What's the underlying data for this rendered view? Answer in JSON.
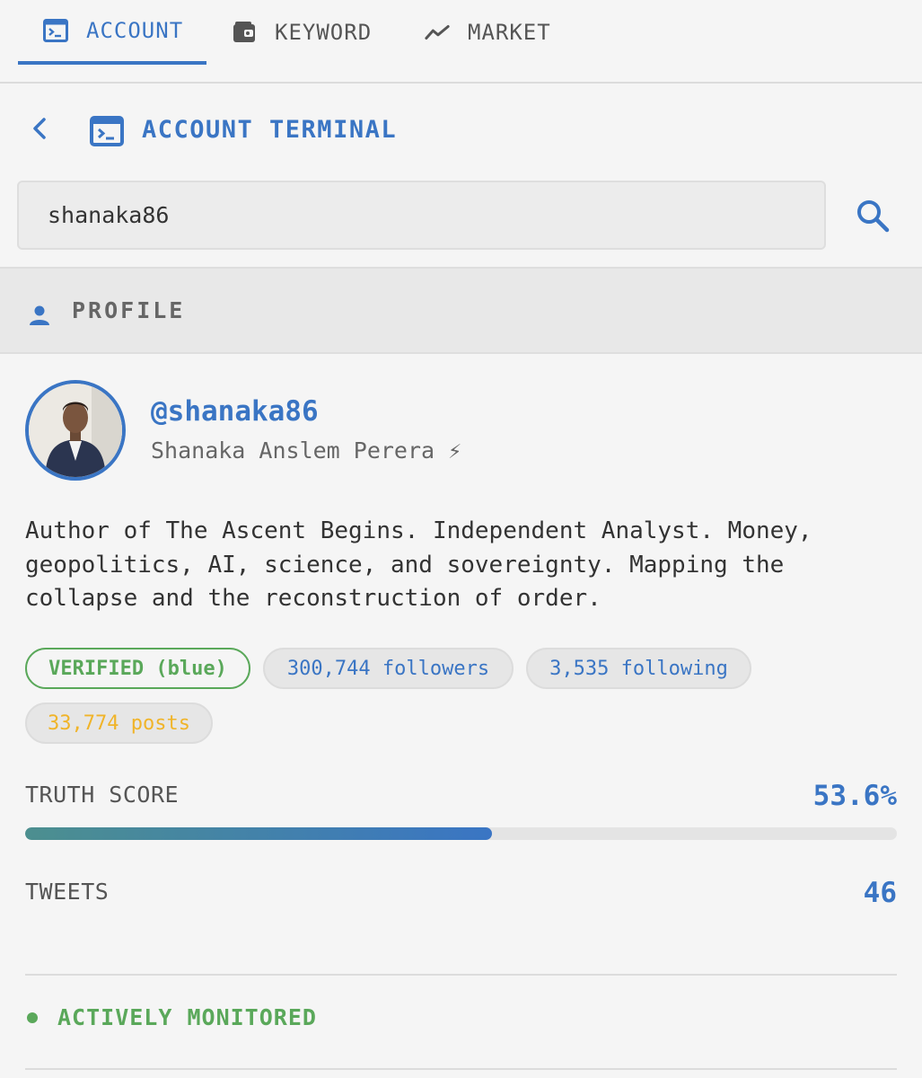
{
  "tabs": [
    {
      "label": "ACCOUNT",
      "icon": "terminal-icon",
      "active": true
    },
    {
      "label": "KEYWORD",
      "icon": "wallet-icon",
      "active": false
    },
    {
      "label": "MARKET",
      "icon": "trend-line-icon",
      "active": false
    }
  ],
  "header": {
    "title": "ACCOUNT TERMINAL"
  },
  "search": {
    "value": "shanaka86"
  },
  "profile_section": {
    "title": "PROFILE"
  },
  "profile": {
    "handle": "@shanaka86",
    "display_name": "Shanaka Anslem Perera ⚡",
    "bio": "Author of The Ascent Begins. Independent Analyst. Money, geopolitics, AI, science, and sovereignty. Mapping the collapse and the reconstruction of order.",
    "badges": {
      "verified": "VERIFIED (blue)",
      "followers": "300,744 followers",
      "following": "3,535 following",
      "posts": "33,774 posts"
    }
  },
  "stats": {
    "truth_score_label": "TRUTH SCORE",
    "truth_score_value": "53.6%",
    "truth_score_fraction": 0.536,
    "tweets_label": "TWEETS",
    "tweets_value": "46"
  },
  "monitor": {
    "status": "ACTIVELY MONITORED"
  },
  "colors": {
    "accent": "#3a75c4",
    "verified": "#5aa85a",
    "posts": "#f0b429",
    "background": "#f5f5f5"
  }
}
